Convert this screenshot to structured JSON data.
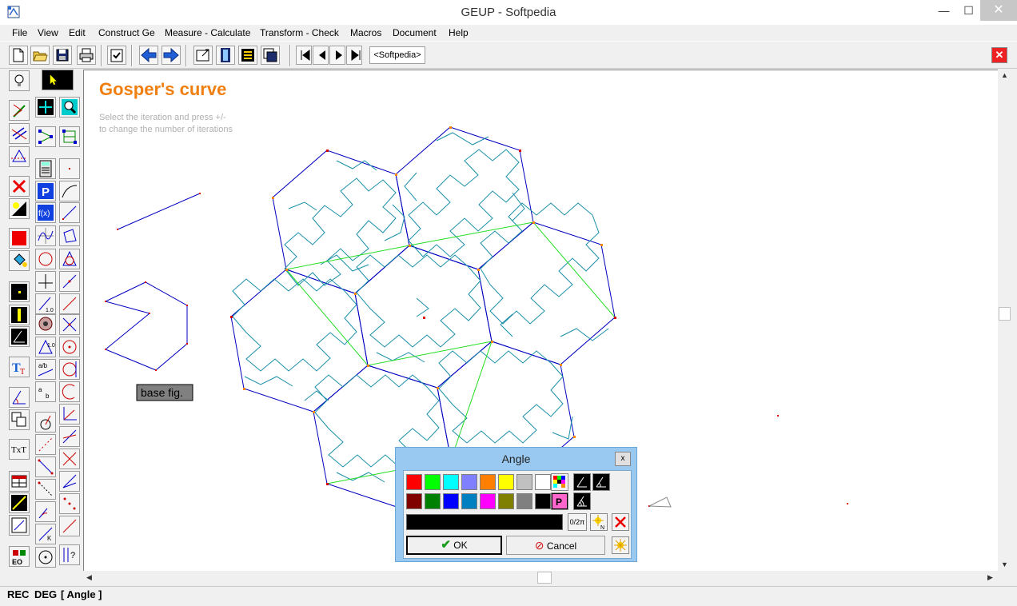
{
  "window": {
    "title": "GEUP - Softpedia",
    "min_glyph": "—",
    "max_glyph": "☐",
    "close_glyph": "✕"
  },
  "menu": [
    "File",
    "View",
    "Edit",
    "Construct Ge",
    "Measure - Calculate",
    "Transform - Check",
    "Macros",
    "Document",
    "Help"
  ],
  "toolbar": {
    "document_tab": "<Softpedia>",
    "close_glyph": "✕"
  },
  "canvas": {
    "heading": "Gosper's curve",
    "instruction_line1": "Select the iteration and press +/-",
    "instruction_line2": "to change the number of iterations",
    "base_fig_label": "base fig."
  },
  "status": {
    "rec": "REC",
    "deg": "DEG",
    "mode": "[ Angle ]"
  },
  "angle_dialog": {
    "title": "Angle",
    "close_glyph": "x",
    "ok_label": "OK",
    "cancel_label": "Cancel",
    "fraction_label": "0/2π",
    "palette_row1": [
      "#ff0000",
      "#00ff00",
      "#00ffff",
      "#8080ff",
      "#ff8000",
      "#ffff00",
      "#c0c0c0",
      "#ffffff"
    ],
    "palette_row2": [
      "#800000",
      "#008000",
      "#0000ff",
      "#0080c0",
      "#ff00ff",
      "#808000",
      "#808080",
      "#000000"
    ]
  },
  "colors": {
    "heading": "#f07f10",
    "outline": "#0000c0",
    "curve": "#1a8fa8",
    "green_lines": "#22dd22",
    "vertex_orange": "#ff8800",
    "vertex_red": "#dd0000"
  }
}
